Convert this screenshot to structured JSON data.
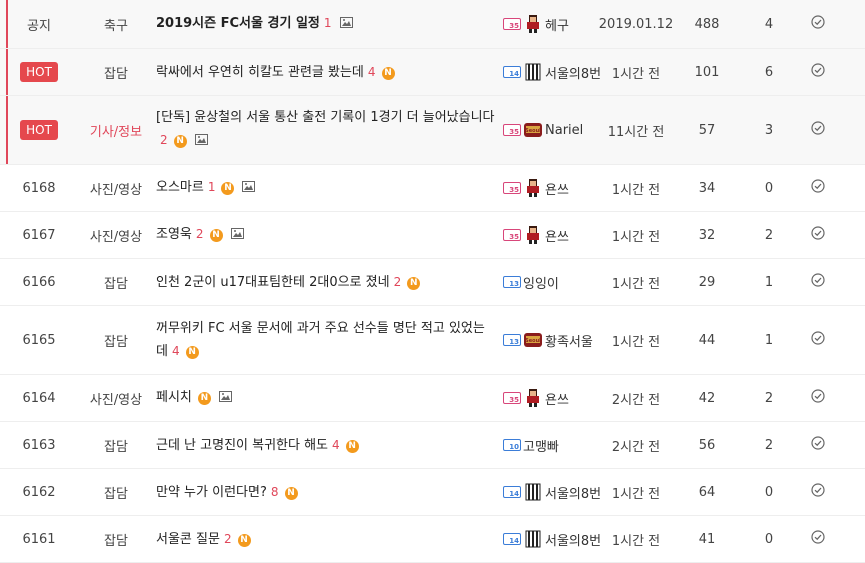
{
  "colors": {
    "accent_red": "#e0475a",
    "hot_bg": "#e5484d",
    "n_badge": "#f39a1d",
    "level_pink": "#d8467a",
    "level_blue": "#3b7dd8"
  },
  "rows": [
    {
      "no": "공지",
      "category": "축구",
      "title": "2019시즌 FC서울 경기 일정",
      "comments": "1",
      "new": false,
      "image": true,
      "author": "헤구",
      "level": "35",
      "avatar": "red-player-avatar-icon",
      "date": "2019.01.12",
      "views": "488",
      "votes": "4"
    },
    {
      "no": "HOT",
      "category": "잡담",
      "title": "락싸에서 우연히 히칼도 관련글 봤는데",
      "comments": "4",
      "new": true,
      "image": false,
      "author": "서울의8번",
      "level": "14",
      "avatar": "striped-jersey-avatar-icon",
      "date": "1시간 전",
      "views": "101",
      "votes": "6"
    },
    {
      "no": "HOT",
      "category": "기사/정보",
      "title": "[단독] 윤상철의 서울 통산 출전 기록이 1경기 더 늘어났습니다",
      "comments": "2",
      "new": true,
      "image": true,
      "author": "Nariel",
      "level": "35",
      "avatar": "seoul-badge-avatar-icon",
      "date": "11시간 전",
      "views": "57",
      "votes": "3"
    },
    {
      "no": "6168",
      "category": "사진/영상",
      "title": "오스마르",
      "comments": "1",
      "new": true,
      "image": true,
      "author": "욘쓰",
      "level": "35",
      "avatar": "red-player-avatar-icon",
      "date": "1시간 전",
      "views": "34",
      "votes": "0"
    },
    {
      "no": "6167",
      "category": "사진/영상",
      "title": "조영욱",
      "comments": "2",
      "new": true,
      "image": true,
      "author": "욘쓰",
      "level": "35",
      "avatar": "red-player-avatar-icon",
      "date": "1시간 전",
      "views": "32",
      "votes": "2"
    },
    {
      "no": "6166",
      "category": "잡담",
      "title": "인천 2군이 u17대표팀한테 2대0으로 졌네",
      "comments": "2",
      "new": true,
      "image": false,
      "author": "잉잉이",
      "level": "13",
      "avatar": "",
      "date": "1시간 전",
      "views": "29",
      "votes": "1"
    },
    {
      "no": "6165",
      "category": "잡담",
      "title": "꺼무위키 FC 서울 문서에 과거 주요 선수들 명단 적고 있었는데",
      "comments": "4",
      "new": true,
      "image": false,
      "author": "황족서울",
      "level": "13",
      "avatar": "seoul-badge-avatar-icon",
      "date": "1시간 전",
      "views": "44",
      "votes": "1"
    },
    {
      "no": "6164",
      "category": "사진/영상",
      "title": "페시치",
      "comments": "",
      "new": true,
      "image": true,
      "author": "욘쓰",
      "level": "35",
      "avatar": "red-player-avatar-icon",
      "date": "2시간 전",
      "views": "42",
      "votes": "2"
    },
    {
      "no": "6163",
      "category": "잡담",
      "title": "근데 난 고명진이 복귀한다 해도",
      "comments": "4",
      "new": true,
      "image": false,
      "author": "고맹빠",
      "level": "10",
      "avatar": "",
      "date": "2시간 전",
      "views": "56",
      "votes": "2"
    },
    {
      "no": "6162",
      "category": "잡담",
      "title": "만약 누가 이런다면?",
      "comments": "8",
      "new": true,
      "image": false,
      "author": "서울의8번",
      "level": "14",
      "avatar": "striped-jersey-avatar-icon",
      "date": "1시간 전",
      "views": "64",
      "votes": "0"
    },
    {
      "no": "6161",
      "category": "잡담",
      "title": "서울콘 질문",
      "comments": "2",
      "new": true,
      "image": false,
      "author": "서울의8번",
      "level": "14",
      "avatar": "striped-jersey-avatar-icon",
      "date": "1시간 전",
      "views": "41",
      "votes": "0"
    }
  ],
  "badges": {
    "new_label": "N"
  }
}
